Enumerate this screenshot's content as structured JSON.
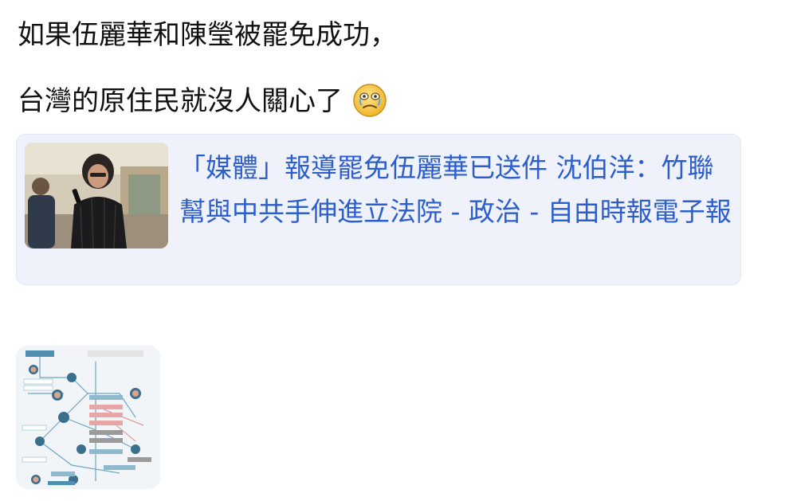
{
  "message": {
    "line1": "如果伍麗華和陳瑩被罷免成功，",
    "line2": "台灣的原住民就沒人關心了",
    "emoji": "crying-face-emoji"
  },
  "link_preview": {
    "title": "「媒體」報導罷免伍麗華已送件 沈伯洋：竹聯幫與中共手伸進立法院 - 政治 - 自由時報電子報",
    "thumbnail": "news-photo-man-with-microphone",
    "background_color": "#eff1fb",
    "link_color": "#2d5fcc"
  },
  "attachment": {
    "thumbnail": "relationship-diagram-image"
  }
}
